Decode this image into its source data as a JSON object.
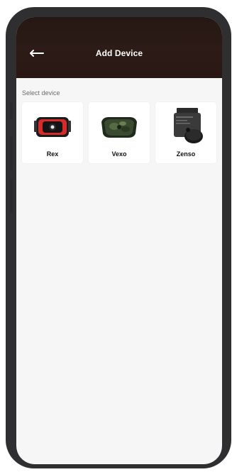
{
  "header": {
    "title": "Add Device",
    "back_icon": "arrow-left-icon"
  },
  "section": {
    "label": "Select device"
  },
  "devices": [
    {
      "name": "Rex",
      "icon": "rex-device-image"
    },
    {
      "name": "Vexo",
      "icon": "vexo-device-image"
    },
    {
      "name": "Zenso",
      "icon": "zenso-device-image"
    }
  ],
  "colors": {
    "header_bg": "#2a1813",
    "screen_bg": "#f6f6f6",
    "card_bg": "#ffffff",
    "accent_red": "#d62b2b"
  }
}
